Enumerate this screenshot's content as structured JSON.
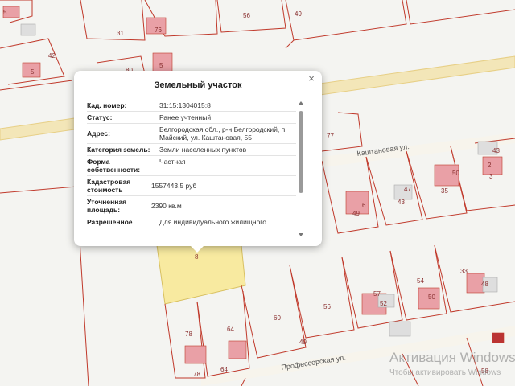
{
  "popup": {
    "title": "Земельный участок",
    "close_symbol": "×",
    "rows": [
      {
        "label": "Кад. номер:",
        "value": "31:15:1304015:8"
      },
      {
        "label": "Статус:",
        "value": "Ранее учтенный"
      },
      {
        "label": "Адрес:",
        "value": "Белгородская обл., р-н Белгородский, п. Майский, ул. Каштановая, 55"
      },
      {
        "label": "Категория земель:",
        "value": "Земли населенных пунктов"
      },
      {
        "label": "Форма собственности:",
        "value": "Частная"
      },
      {
        "label": "Кадастровая стоимость",
        "value": "1557443.5 руб"
      },
      {
        "label": "Уточненная площадь:",
        "value": "2390 кв.м"
      },
      {
        "label": "Разрешенное",
        "value": "Для индивидуального жилищного"
      }
    ]
  },
  "map": {
    "streets": [
      "Каштановая ул.",
      "Профессорская ул."
    ],
    "parcel_numbers": [
      "5",
      "56",
      "49",
      "31",
      "76",
      "42",
      "80",
      "5",
      "5",
      "77",
      "43",
      "2",
      "3",
      "47",
      "35",
      "43",
      "49",
      "6",
      "50",
      "8",
      "33",
      "48",
      "57",
      "52",
      "54",
      "50",
      "56",
      "60",
      "49",
      "78",
      "64",
      "78",
      "64",
      "58"
    ],
    "selected_parcel_marker": "8",
    "colors": {
      "parcel_border": "#c0392b",
      "selected_fill": "#f8eaa0",
      "building": "#e9a0a6",
      "road": "#f2e4b4"
    }
  },
  "watermark": {
    "line1": "Активация Windows",
    "line2": "Чтобы активировать Windows"
  }
}
